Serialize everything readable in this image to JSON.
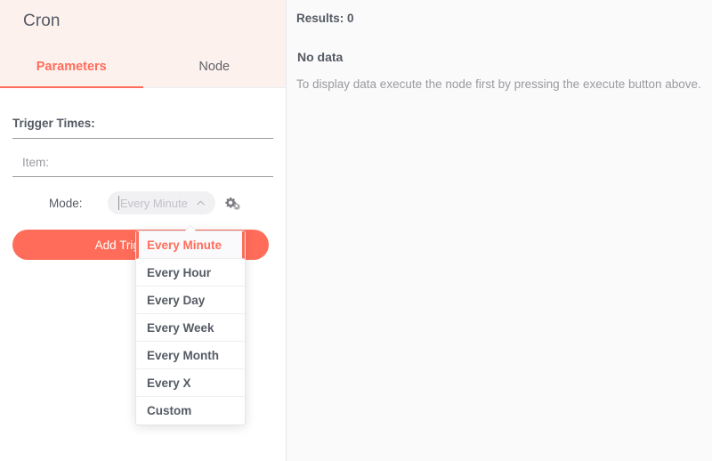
{
  "node": {
    "title": "Cron"
  },
  "tabs": [
    {
      "label": "Parameters",
      "active": true
    },
    {
      "label": "Node",
      "active": false
    }
  ],
  "parameters": {
    "trigger_times_label": "Trigger Times:",
    "item_label": "Item:",
    "mode_label": "Mode:",
    "mode_select": {
      "value": "",
      "placeholder": "Every Minute",
      "arrow_icon": "chevron-up-icon"
    },
    "settings_icon": "gears-icon",
    "add_button_label": "Add Trigger Time"
  },
  "dropdown": {
    "open": true,
    "selected": "Every Minute",
    "options": [
      "Every Minute",
      "Every Hour",
      "Every Day",
      "Every Week",
      "Every Month",
      "Every X",
      "Custom"
    ]
  },
  "results": {
    "header": "Results: 0",
    "empty_title": "No data",
    "empty_description": "To display data execute the node first by pressing the execute button above."
  },
  "colors": {
    "accent": "#ff6d5a",
    "header_bg": "#fdf1ee",
    "panel_bg": "#fafafa",
    "text": "#555a64",
    "muted_text": "#9a9aa0"
  }
}
